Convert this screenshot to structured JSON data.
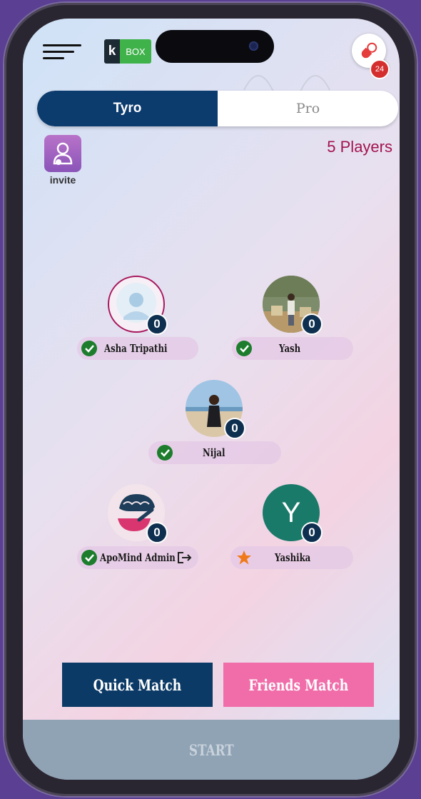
{
  "header": {
    "logo_k": "k",
    "logo_box": "BOX",
    "notification_count": "24",
    "menu_icon": "hamburger-menu-icon",
    "pill_icon": "capsule-icon"
  },
  "mode_toggle": {
    "tabs": [
      {
        "label": "Tyro",
        "active": true
      },
      {
        "label": "Pro",
        "active": false
      }
    ]
  },
  "invite": {
    "label": "invite",
    "icon": "add-user-icon"
  },
  "players_count": "5 Players",
  "players": [
    {
      "name": "Asha Tripathi",
      "score": "0",
      "status": "ready",
      "avatar": "default-user-avatar"
    },
    {
      "name": "Yash",
      "score": "0",
      "status": "ready",
      "avatar": "photo"
    },
    {
      "name": "Nijal",
      "score": "0",
      "status": "ready",
      "avatar": "photo"
    },
    {
      "name": "ApoMind Admin",
      "score": "0",
      "status": "ready",
      "avatar": "apomind-logo",
      "extra_icon": "exit-icon"
    },
    {
      "name": "Yashika",
      "score": "0",
      "status": "host",
      "avatar_letter": "Y"
    }
  ],
  "buttons": {
    "quick_match": "Quick Match",
    "friends_match": "Friends Match",
    "start": "START"
  },
  "colors": {
    "primary": "#0c3b6e",
    "accent_pink": "#f06daa",
    "players_count": "#a3134e",
    "check": "#1d7d2d",
    "star": "#f07a1a",
    "yashika_avatar": "#1a7a6a"
  }
}
